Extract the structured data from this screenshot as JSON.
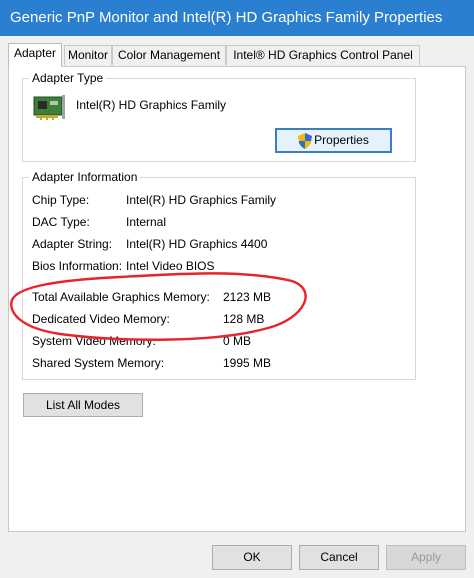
{
  "window": {
    "title": "Generic PnP Monitor and Intel(R) HD Graphics Family Properties"
  },
  "tabs": [
    {
      "label": "Adapter",
      "active": true
    },
    {
      "label": "Monitor",
      "active": false
    },
    {
      "label": "Color Management",
      "active": false
    },
    {
      "label": "Intel® HD Graphics Control Panel",
      "active": false
    }
  ],
  "adapter_type": {
    "group_label": "Adapter Type",
    "adapter_name": "Intel(R) HD Graphics Family",
    "properties_button": "Properties",
    "properties_icon": "shield-icon"
  },
  "adapter_info": {
    "group_label": "Adapter Information",
    "rows": [
      {
        "label": "Chip Type:",
        "value": "Intel(R) HD Graphics Family"
      },
      {
        "label": "DAC Type:",
        "value": "Internal"
      },
      {
        "label": "Adapter String:",
        "value": "Intel(R) HD Graphics 4400"
      },
      {
        "label": "Bios Information:",
        "value": "Intel Video BIOS"
      }
    ],
    "memory_rows": [
      {
        "label": "Total Available Graphics Memory:",
        "value": "2123 MB"
      },
      {
        "label": "Dedicated Video Memory:",
        "value": "128 MB"
      },
      {
        "label": "System Video Memory:",
        "value": "0 MB"
      },
      {
        "label": "Shared System Memory:",
        "value": "1995 MB"
      }
    ]
  },
  "list_all_modes_button": "List All Modes",
  "footer": {
    "ok": "OK",
    "cancel": "Cancel",
    "apply": "Apply"
  },
  "colors": {
    "title_bar": "#2b7fd1",
    "annotation": "#e8242a",
    "focus": "#3d7ec2"
  }
}
